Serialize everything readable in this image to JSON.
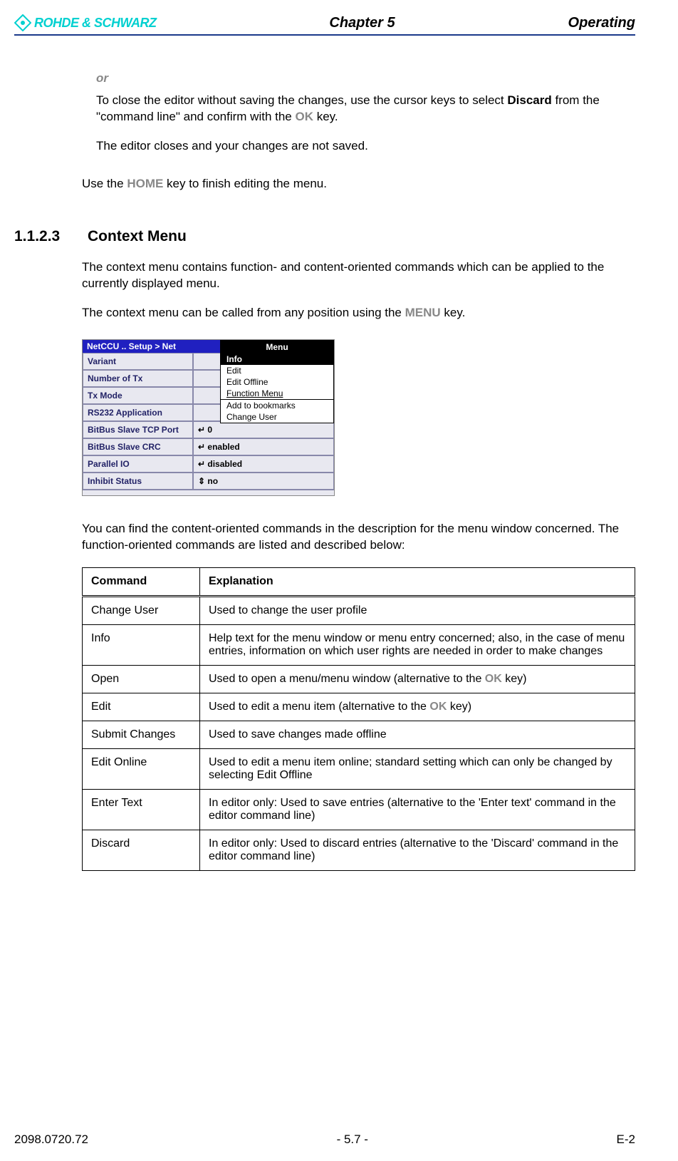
{
  "header": {
    "brand": "ROHDE & SCHWARZ",
    "center": "Chapter 5",
    "right": "Operating"
  },
  "body": {
    "or_label": "or",
    "p1_prefix": "To close the editor without saving the changes, use the cursor keys to select ",
    "p1_bold": "Discard",
    "p1_mid": " from the \"command line\" and confirm with the ",
    "p1_key": "OK",
    "p1_suffix": " key.",
    "p2": "The editor closes and your changes are not saved.",
    "p3_prefix": "Use the ",
    "p3_key": "HOME",
    "p3_suffix": " key to finish editing the menu.",
    "section_num": "1.1.2.3",
    "section_title": "Context Menu",
    "p4": "The context menu contains function- and content-oriented commands which can be applied to the currently displayed menu.",
    "p5_prefix": "The context menu can be called from any position using the ",
    "p5_key": "MENU",
    "p5_suffix": " key.",
    "p6": "You can find the content-oriented commands in the description for the menu window concerned. The function-oriented commands are listed and described below:"
  },
  "mock": {
    "title": "NetCCU .. Setup > Net",
    "rows": [
      {
        "label": "Variant",
        "val": ""
      },
      {
        "label": "Number of Tx",
        "val": ""
      },
      {
        "label": "Tx Mode",
        "val": ""
      },
      {
        "label": "RS232 Application",
        "val": ""
      },
      {
        "label": "BitBus Slave TCP Port",
        "val": "↵ 0"
      },
      {
        "label": "BitBus Slave CRC",
        "val": "↵ enabled"
      },
      {
        "label": "Parallel IO",
        "val": "↵ disabled"
      },
      {
        "label": "Inhibit Status",
        "val": "⇕ no"
      }
    ],
    "popup_title": "Menu",
    "popup_items": [
      {
        "t": "Info",
        "sel": true
      },
      {
        "t": "Edit"
      },
      {
        "t": "Edit Offline"
      },
      {
        "t": "Function Menu",
        "underline": true
      },
      {
        "t": "Add to bookmarks"
      },
      {
        "t": "Change User"
      }
    ]
  },
  "table": {
    "h1": "Command",
    "h2": "Explanation",
    "rows": [
      {
        "c": "Change User",
        "e": "Used to change the user profile"
      },
      {
        "c": "Info",
        "e": "Help text for the menu window or menu entry concerned; also, in the case of menu entries, information on which user rights are needed in order to make changes"
      },
      {
        "c": "Open",
        "e_pre": "Used to open a menu/menu window (alternative to the ",
        "e_key": "OK",
        "e_post": " key)"
      },
      {
        "c": "Edit",
        "e_pre": "Used to edit a menu item (alternative to the ",
        "e_key": "OK",
        "e_post": " key)"
      },
      {
        "c": "Submit Changes",
        "e": "Used to save changes made offline"
      },
      {
        "c": "Edit Online",
        "e": "Used to edit a menu item online; standard setting which can only be changed by selecting Edit Offline"
      },
      {
        "c": "Enter Text",
        "e": "In editor only: Used to save entries (alternative to the 'Enter text' command in the editor command line)"
      },
      {
        "c": "Discard",
        "e": "In editor only: Used to discard entries (alternative to the 'Discard' command in the editor command line)"
      }
    ]
  },
  "footer": {
    "left": "2098.0720.72",
    "center": "- 5.7 -",
    "right": "E-2"
  }
}
